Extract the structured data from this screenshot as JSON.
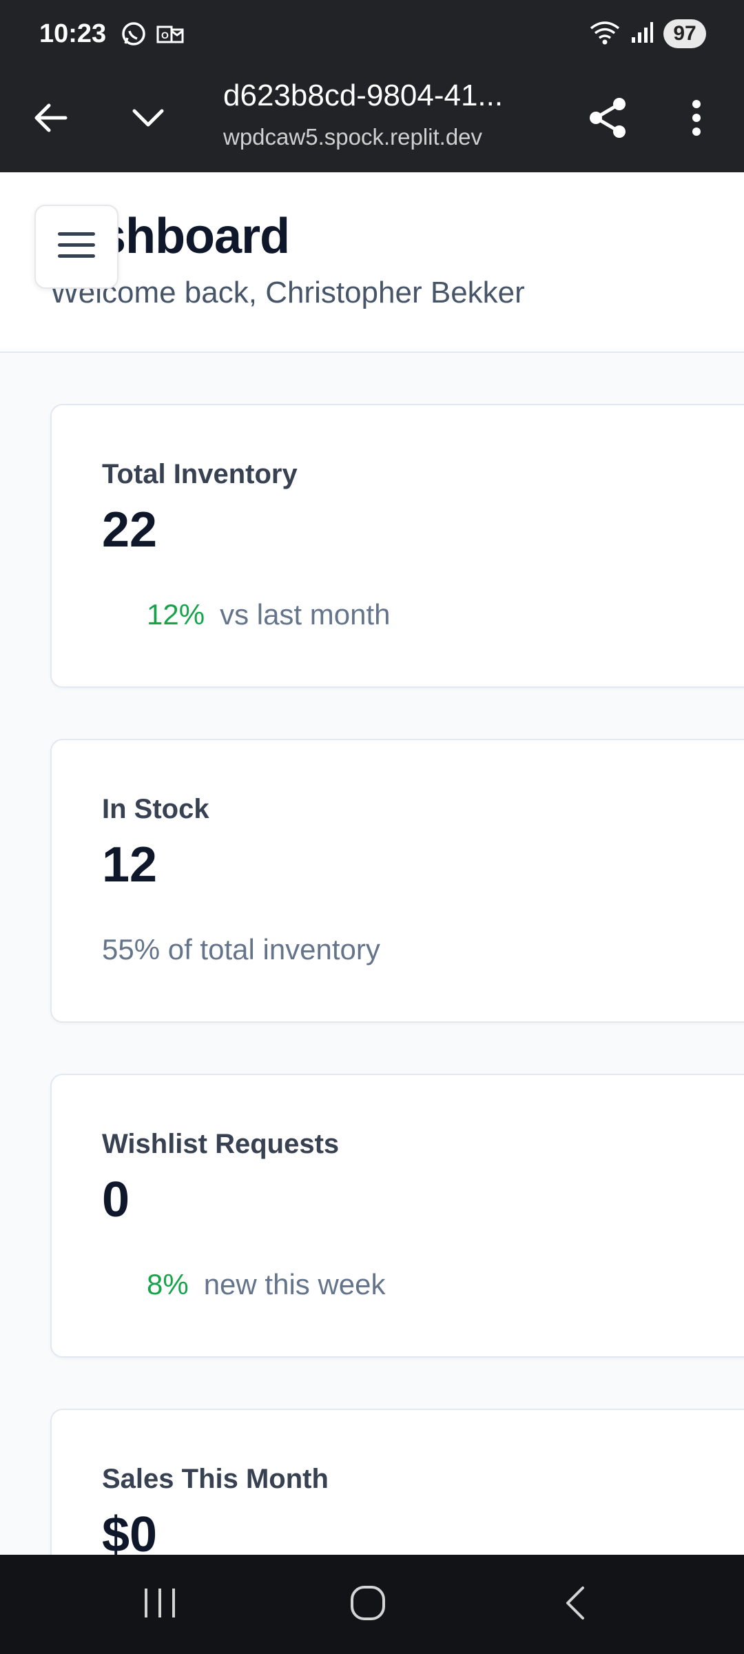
{
  "status_bar": {
    "time": "10:23",
    "battery": "97",
    "icons": [
      "whatsapp-icon",
      "outlook-icon",
      "wifi-icon",
      "signal-icon"
    ]
  },
  "browser": {
    "title": "d623b8cd-9804-41...",
    "domain": "wpdcaw5.spock.replit.dev",
    "icons": [
      "back-arrow-icon",
      "chevron-down-icon",
      "share-icon",
      "more-vert-icon"
    ]
  },
  "header": {
    "title": "Dashboard",
    "subtitle": "Welcome back, Christopher Bekker"
  },
  "cards": [
    {
      "label": "Total Inventory",
      "value": "22",
      "pct": "12%",
      "note": "vs last month"
    },
    {
      "label": "In Stock",
      "value": "12",
      "note": "55% of total inventory"
    },
    {
      "label": "Wishlist Requests",
      "value": "0",
      "pct": "8%",
      "note": "new this week"
    },
    {
      "label": "Sales This Month",
      "value": "$0"
    }
  ],
  "colors": {
    "positive": "#16a34a",
    "dark_bar": "#222327",
    "title_text": "#0f172a"
  }
}
